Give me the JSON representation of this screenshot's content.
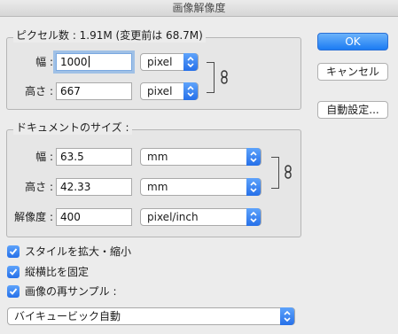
{
  "window": {
    "title": "画像解像度"
  },
  "pixel_dimensions": {
    "legend": "ピクセル数 : 1.91M (変更前は 68.7M)",
    "width_label": "幅 :",
    "width_value": "1000",
    "width_unit": "pixel",
    "height_label": "高さ :",
    "height_value": "667",
    "height_unit": "pixel"
  },
  "document_size": {
    "legend": "ドキュメントのサイズ :",
    "width_label": "幅 :",
    "width_value": "63.5",
    "width_unit": "mm",
    "height_label": "高さ :",
    "height_value": "42.33",
    "height_unit": "mm",
    "resolution_label": "解像度 :",
    "resolution_value": "400",
    "resolution_unit": "pixel/inch"
  },
  "options": {
    "scale_styles": {
      "label": "スタイルを拡大・縮小",
      "checked": true
    },
    "constrain_proportions": {
      "label": "縦横比を固定",
      "checked": true
    },
    "resample": {
      "label": "画像の再サンプル :",
      "checked": true
    }
  },
  "resample_method": "バイキュービック自動",
  "buttons": {
    "ok": "OK",
    "cancel": "キャンセル",
    "auto": "自動設定..."
  },
  "colors": {
    "accent": "#2670e9",
    "background": "#ececec"
  },
  "icons": {
    "link": "chain-link-icon",
    "stepper": "up-down-arrows-icon",
    "check": "checkmark-icon"
  }
}
